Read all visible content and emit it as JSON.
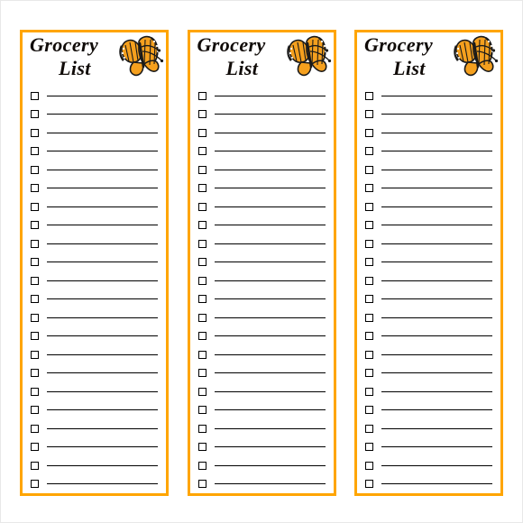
{
  "document": {
    "type": "printable-checklist-template",
    "page_background": "#ffffff",
    "accent_color": "#FFA500",
    "line_color": "#000000",
    "title_color": "#100b08",
    "card_count": 3,
    "rows_per_card": 22
  },
  "cards": [
    {
      "title_line1": "Grocery",
      "title_line2": "List",
      "decoration": "monarch-butterfly",
      "rows": [
        {
          "checked": false,
          "text": ""
        },
        {
          "checked": false,
          "text": ""
        },
        {
          "checked": false,
          "text": ""
        },
        {
          "checked": false,
          "text": ""
        },
        {
          "checked": false,
          "text": ""
        },
        {
          "checked": false,
          "text": ""
        },
        {
          "checked": false,
          "text": ""
        },
        {
          "checked": false,
          "text": ""
        },
        {
          "checked": false,
          "text": ""
        },
        {
          "checked": false,
          "text": ""
        },
        {
          "checked": false,
          "text": ""
        },
        {
          "checked": false,
          "text": ""
        },
        {
          "checked": false,
          "text": ""
        },
        {
          "checked": false,
          "text": ""
        },
        {
          "checked": false,
          "text": ""
        },
        {
          "checked": false,
          "text": ""
        },
        {
          "checked": false,
          "text": ""
        },
        {
          "checked": false,
          "text": ""
        },
        {
          "checked": false,
          "text": ""
        },
        {
          "checked": false,
          "text": ""
        },
        {
          "checked": false,
          "text": ""
        },
        {
          "checked": false,
          "text": ""
        }
      ]
    },
    {
      "title_line1": "Grocery",
      "title_line2": "List",
      "decoration": "monarch-butterfly",
      "rows": [
        {
          "checked": false,
          "text": ""
        },
        {
          "checked": false,
          "text": ""
        },
        {
          "checked": false,
          "text": ""
        },
        {
          "checked": false,
          "text": ""
        },
        {
          "checked": false,
          "text": ""
        },
        {
          "checked": false,
          "text": ""
        },
        {
          "checked": false,
          "text": ""
        },
        {
          "checked": false,
          "text": ""
        },
        {
          "checked": false,
          "text": ""
        },
        {
          "checked": false,
          "text": ""
        },
        {
          "checked": false,
          "text": ""
        },
        {
          "checked": false,
          "text": ""
        },
        {
          "checked": false,
          "text": ""
        },
        {
          "checked": false,
          "text": ""
        },
        {
          "checked": false,
          "text": ""
        },
        {
          "checked": false,
          "text": ""
        },
        {
          "checked": false,
          "text": ""
        },
        {
          "checked": false,
          "text": ""
        },
        {
          "checked": false,
          "text": ""
        },
        {
          "checked": false,
          "text": ""
        },
        {
          "checked": false,
          "text": ""
        },
        {
          "checked": false,
          "text": ""
        }
      ]
    },
    {
      "title_line1": "Grocery",
      "title_line2": "List",
      "decoration": "monarch-butterfly",
      "rows": [
        {
          "checked": false,
          "text": ""
        },
        {
          "checked": false,
          "text": ""
        },
        {
          "checked": false,
          "text": ""
        },
        {
          "checked": false,
          "text": ""
        },
        {
          "checked": false,
          "text": ""
        },
        {
          "checked": false,
          "text": ""
        },
        {
          "checked": false,
          "text": ""
        },
        {
          "checked": false,
          "text": ""
        },
        {
          "checked": false,
          "text": ""
        },
        {
          "checked": false,
          "text": ""
        },
        {
          "checked": false,
          "text": ""
        },
        {
          "checked": false,
          "text": ""
        },
        {
          "checked": false,
          "text": ""
        },
        {
          "checked": false,
          "text": ""
        },
        {
          "checked": false,
          "text": ""
        },
        {
          "checked": false,
          "text": ""
        },
        {
          "checked": false,
          "text": ""
        },
        {
          "checked": false,
          "text": ""
        },
        {
          "checked": false,
          "text": ""
        },
        {
          "checked": false,
          "text": ""
        },
        {
          "checked": false,
          "text": ""
        },
        {
          "checked": false,
          "text": ""
        }
      ]
    }
  ]
}
